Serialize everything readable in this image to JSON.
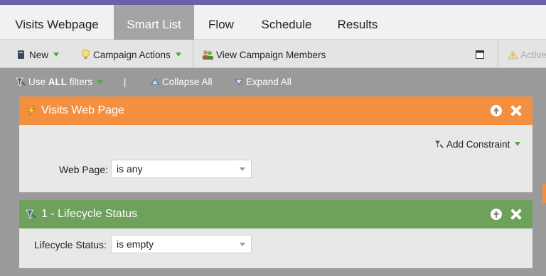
{
  "colors": {
    "top_strip": "#6a62a8",
    "active_tab": "#a4a4a4",
    "orange_header": "#f58f40",
    "green_header": "#6ea15c",
    "background": "#9a9a9a"
  },
  "tabs": [
    {
      "label": "Visits Webpage",
      "active": false
    },
    {
      "label": "Smart List",
      "active": true
    },
    {
      "label": "Flow",
      "active": false
    },
    {
      "label": "Schedule",
      "active": false
    },
    {
      "label": "Results",
      "active": false
    }
  ],
  "toolbar": {
    "new_label": "New",
    "campaign_actions_label": "Campaign Actions",
    "view_members_label": "View Campaign Members",
    "active_label": "Active"
  },
  "filterbar": {
    "use_filters_prefix": "Use",
    "use_filters_bold": "ALL",
    "use_filters_suffix": "filters",
    "separator": "|",
    "collapse_label": "Collapse All",
    "expand_label": "Expand All"
  },
  "trigger_card": {
    "title": "Visits Web Page",
    "add_constraint_label": "Add Constraint",
    "field_label": "Web Page:",
    "field_value": "is any"
  },
  "filter_card": {
    "title": "1 - Lifecycle Status",
    "field_label": "Lifecycle Status:",
    "field_value": "is empty"
  }
}
